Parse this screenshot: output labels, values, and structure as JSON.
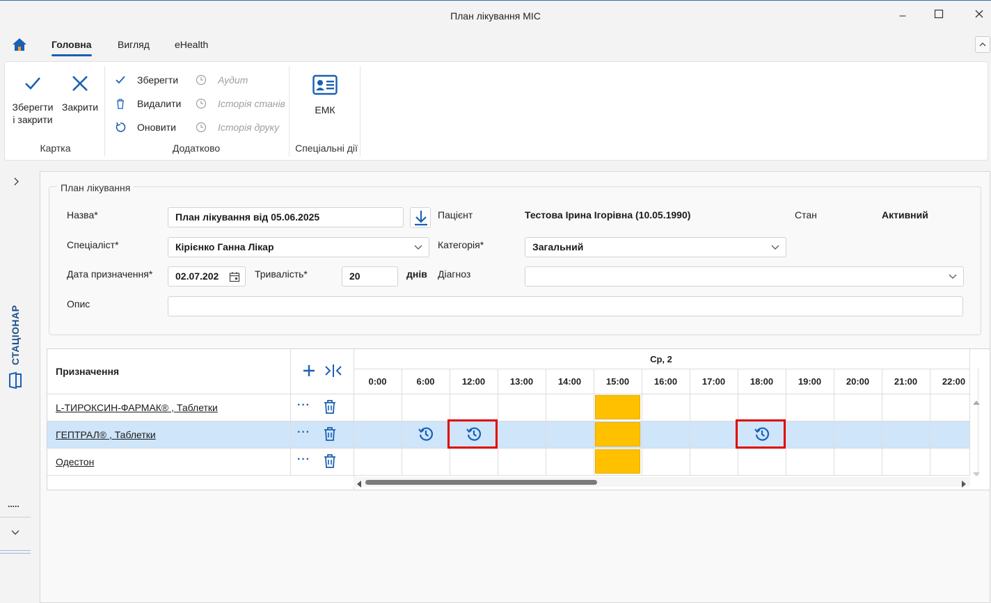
{
  "window": {
    "title": "План лікування МІС"
  },
  "tabs": [
    "Головна",
    "Вигляд",
    "eHealth"
  ],
  "ribbon": {
    "card_group": {
      "label": "Картка",
      "save_close": [
        "Зберегти",
        "і закрити"
      ],
      "close": "Закрити"
    },
    "extra_group": {
      "label": "Додатково",
      "save": "Зберегти",
      "delete": "Видалити",
      "refresh": "Оновити",
      "audit": "Аудит",
      "state_history": "Історія станів",
      "print_history": "Історія друку"
    },
    "special_group": {
      "label": "Спеціальні дії",
      "emk": "ЕМК"
    }
  },
  "sidebar": {
    "vertical_label": "СТАЦІОНАР",
    "dots": "....."
  },
  "form": {
    "legend": "План лікування",
    "name_label": "Назва*",
    "name_value": "План лікування від 05.06.2025",
    "patient_label": "Пацієнт",
    "patient_value": "Тестова Ірина Ігорівна (10.05.1990)",
    "state_label": "Стан",
    "state_value": "Активний",
    "specialist_label": "Спеціаліст*",
    "specialist_value": "Кірієнко Ганна Лікар",
    "category_label": "Категорія*",
    "category_value": "Загальний",
    "date_label": "Дата призначення*",
    "date_value": "02.07.202",
    "duration_label": "Тривалість*",
    "duration_value": "20",
    "duration_unit": "днів",
    "diagnosis_label": "Діагноз",
    "diagnosis_value": "",
    "description_label": "Опис",
    "description_value": ""
  },
  "grid": {
    "col_header": "Призначення",
    "day_header": "Ср, 2",
    "hours": [
      "0:00",
      "6:00",
      "12:00",
      "13:00",
      "14:00",
      "15:00",
      "16:00",
      "17:00",
      "18:00",
      "19:00",
      "20:00",
      "21:00",
      "22:00"
    ],
    "rows": [
      {
        "name": "L-ТИРОКСИН-ФАРМАК® , Таблетки",
        "selected": false,
        "history_at": []
      },
      {
        "name": "ГЕПТРАЛ® , Таблетки",
        "selected": true,
        "history_at": [
          "6:00",
          "12:00",
          "18:00"
        ]
      },
      {
        "name": "Одестон",
        "selected": false,
        "history_at": []
      }
    ],
    "highlight_hour": "15:00",
    "highlight_color": "#ffc000",
    "marked_hours": [
      "12:00",
      "18:00"
    ],
    "row_menu": "···"
  }
}
